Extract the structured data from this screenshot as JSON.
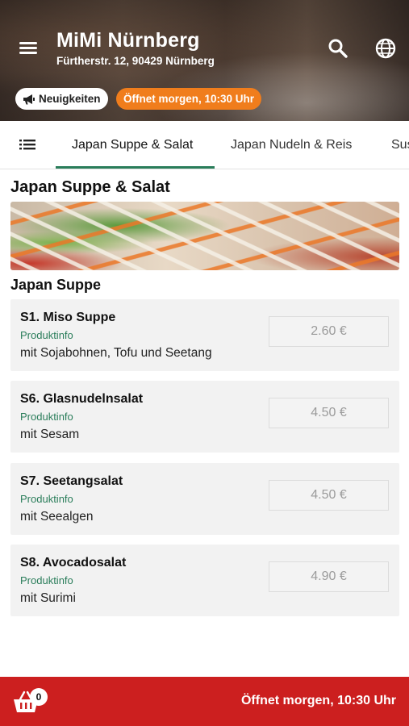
{
  "header": {
    "title": "MiMi Nürnberg",
    "address": "Fürtherstr. 12, 90429 Nürnberg",
    "menu_icon": "hamburger-icon",
    "search_icon": "search-icon",
    "language_icon": "globe-icon",
    "news_label": "Neuigkeiten",
    "news_icon": "megaphone-icon",
    "status_label": "Öffnet morgen, 10:30 Uhr"
  },
  "tabs": {
    "list_icon": "list-icon",
    "items": [
      {
        "label": "Japan Suppe & Salat",
        "active": true
      },
      {
        "label": "Japan Nudeln & Reis",
        "active": false
      },
      {
        "label": "Sus",
        "active": false
      }
    ]
  },
  "section": {
    "title": "Japan Suppe & Salat",
    "subtitle": "Japan Suppe",
    "products": [
      {
        "name": "S1. Miso Suppe",
        "info": "Produktinfo",
        "description": "mit Sojabohnen, Tofu und Seetang",
        "price": "2.60 €"
      },
      {
        "name": "S6. Glasnudelnsalat",
        "info": "Produktinfo",
        "description": "mit Sesam",
        "price": "4.50 €"
      },
      {
        "name": "S7. Seetangsalat",
        "info": "Produktinfo",
        "description": "mit Seealgen",
        "price": "4.50 €"
      },
      {
        "name": "S8. Avocadosalat",
        "info": "Produktinfo",
        "description": "mit Surimi",
        "price": "4.90 €"
      }
    ]
  },
  "footer": {
    "cart_icon": "basket-icon",
    "cart_count": "0",
    "status": "Öffnet morgen, 10:30 Uhr"
  },
  "colors": {
    "accent_green": "#2a7d5a",
    "status_orange": "#f07d1c",
    "footer_red": "#cc1f1f"
  }
}
